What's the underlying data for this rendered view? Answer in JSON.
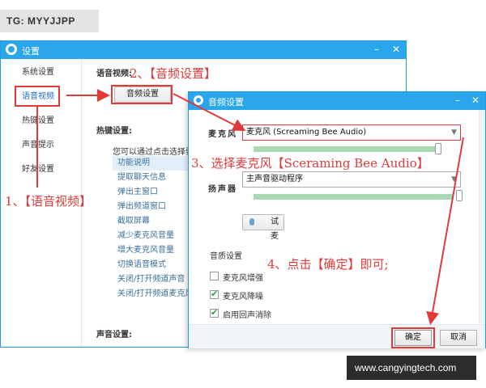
{
  "watermarks": {
    "top_left": "TG: MYYJJPP",
    "bottom_right": "www.cangyingtech.com"
  },
  "main_window": {
    "title": "设置",
    "controls": {
      "minimize": "–",
      "close": "✕"
    },
    "sidebar": [
      "系统设置",
      "语音视频",
      "热键设置",
      "声音提示",
      "好友设置"
    ],
    "section_voice": "语音视频:",
    "audio_button": "音频设置",
    "section_hotkey": "热键设置:",
    "hotkey_hint": "您可以通过点击选择要",
    "hotkeys": [
      "功能说明",
      "提取聊天信息",
      "弹出主窗口",
      "弹出频道窗口",
      "截取屏幕",
      "减少麦克风音量",
      "增大麦克风音量",
      "切换语音模式",
      "关闭/打开频道声音",
      "关闭/打开频道麦克风"
    ],
    "section_sound": "声音设置:"
  },
  "audio_dialog": {
    "title": "音频设置",
    "controls": {
      "minimize": "–",
      "close": "✕"
    },
    "mic_label": "麦克风",
    "mic_value": "麦克风 (Screaming Bee Audio)",
    "speaker_label": "扬声器",
    "speaker_value": "主声音驱动程序",
    "test_button": "试麦",
    "quality_title": "音质设置",
    "options": [
      {
        "label": "麦克风增强",
        "checked": false
      },
      {
        "label": "麦克风降噪",
        "checked": true
      },
      {
        "label": "启用回声消除",
        "checked": true
      }
    ],
    "ok": "确定",
    "cancel": "取消"
  },
  "annotations": {
    "step1": "1、【语音视频】",
    "step2": "2、【音频设置】",
    "step3": "3、选择麦克风【Sceraming Bee Audio】",
    "step4": "4、点击【确定】即可;"
  },
  "colors": {
    "title_bar": "#2aa6ec",
    "annotation": "#e23a3a",
    "meter": "#a9d8b5"
  },
  "icons": [
    "gear-icon",
    "microphone-icon",
    "check-icon",
    "dropdown-arrow-icon"
  ]
}
